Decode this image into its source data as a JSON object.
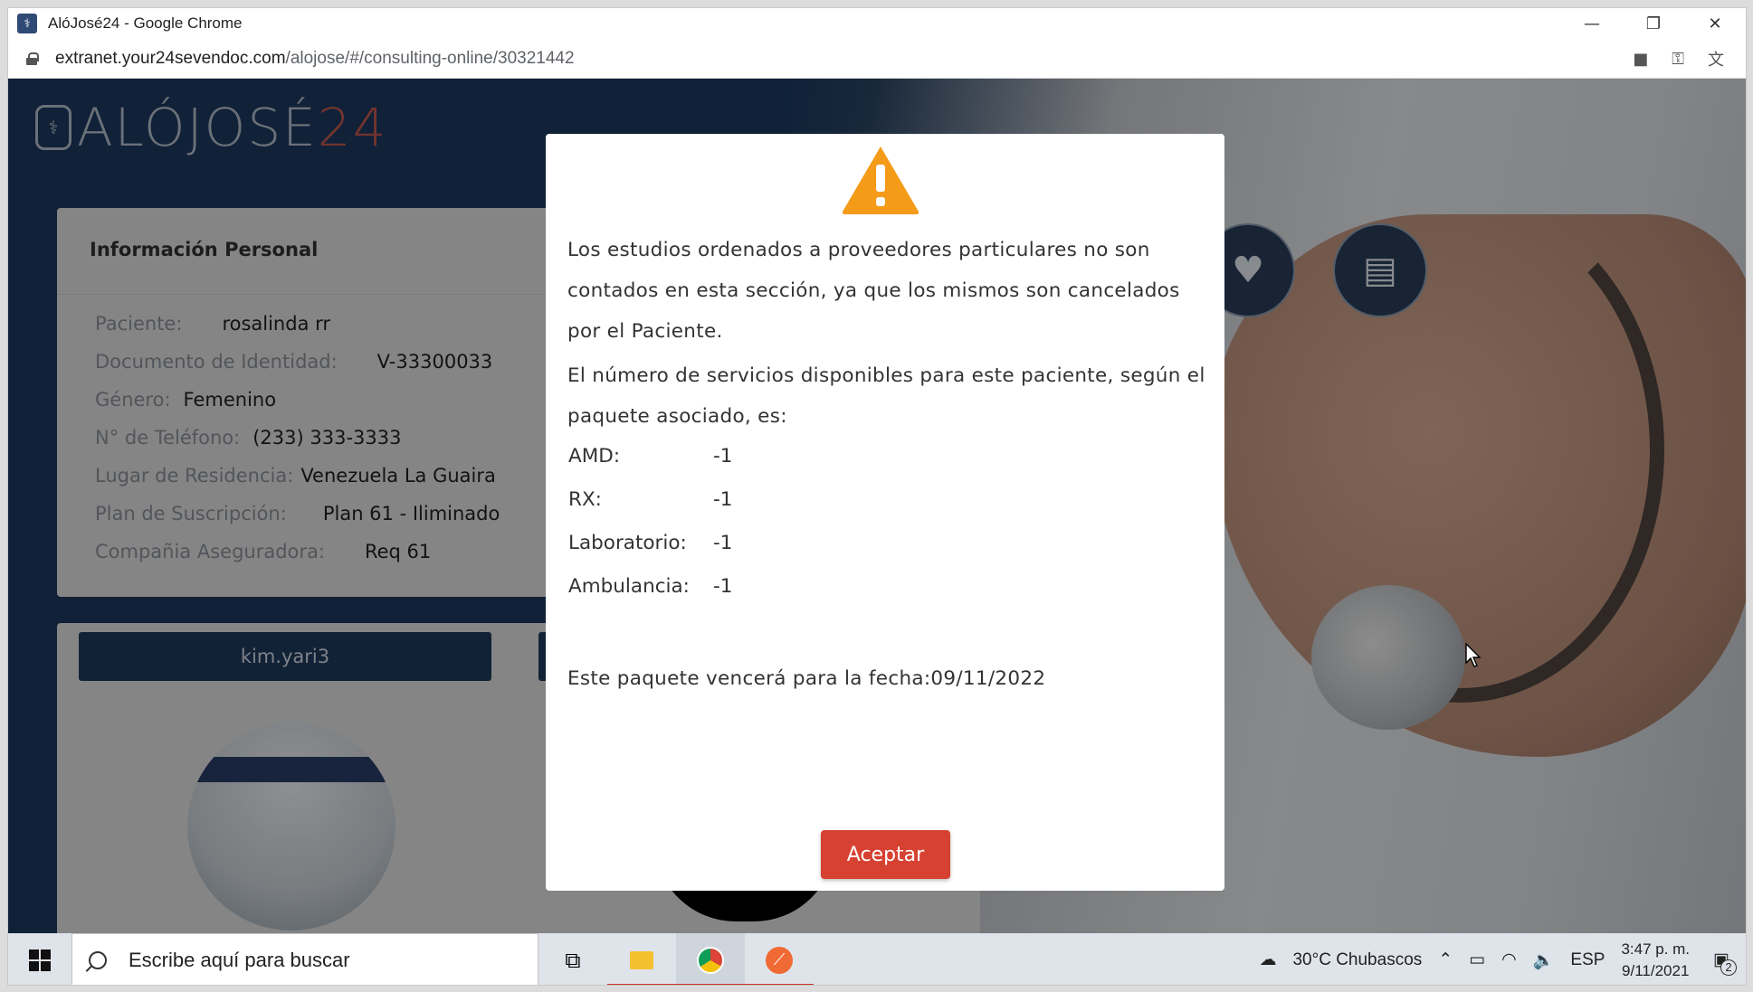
{
  "browser": {
    "title": "AlóJosé24 - Google Chrome",
    "url_domain": "extranet.your24sevendoc.com",
    "url_path": "/alojose/#/consulting-online/30321442"
  },
  "logo": {
    "text": "ALÓJOSÉ",
    "number": "24"
  },
  "personal_info": {
    "heading": "Información Personal",
    "rows": [
      {
        "label": "Paciente:",
        "value": "rosalinda rr"
      },
      {
        "label": "Documento de Identidad:",
        "value": "V-33300033"
      },
      {
        "label": "Género:",
        "value": "Femenino"
      },
      {
        "label": "N° de Teléfono:",
        "value": "(233) 333-3333"
      },
      {
        "label": "Lugar de Residencia:",
        "value": "Venezuela La Guaira"
      },
      {
        "label": "Plan de Suscripción:",
        "value": "Plan 61 - Iliminado"
      },
      {
        "label": "Compañia Aseguradora:",
        "value": "Req 61"
      }
    ]
  },
  "user_button": "kim.yari3",
  "modal": {
    "paragraph1": "Los estudios ordenados a proveedores particulares no son contados en esta sección, ya que los mismos son cancelados por el Paciente.",
    "paragraph2": "El número de servicios disponibles para este paciente, según el paquete asociado, es:",
    "services": [
      {
        "label": "AMD:",
        "value": "-1"
      },
      {
        "label": "RX:",
        "value": "-1"
      },
      {
        "label": "Laboratorio:",
        "value": "-1"
      },
      {
        "label": "Ambulancia:",
        "value": "-1"
      }
    ],
    "expiry": "Este paquete vencerá para la fecha:09/11/2022",
    "accept_label": "Aceptar"
  },
  "taskbar": {
    "search_placeholder": "Escribe aquí para buscar",
    "weather": "30°C  Chubascos",
    "language": "ESP",
    "time": "3:47 p. m.",
    "date": "9/11/2021",
    "notification_count": "2"
  }
}
